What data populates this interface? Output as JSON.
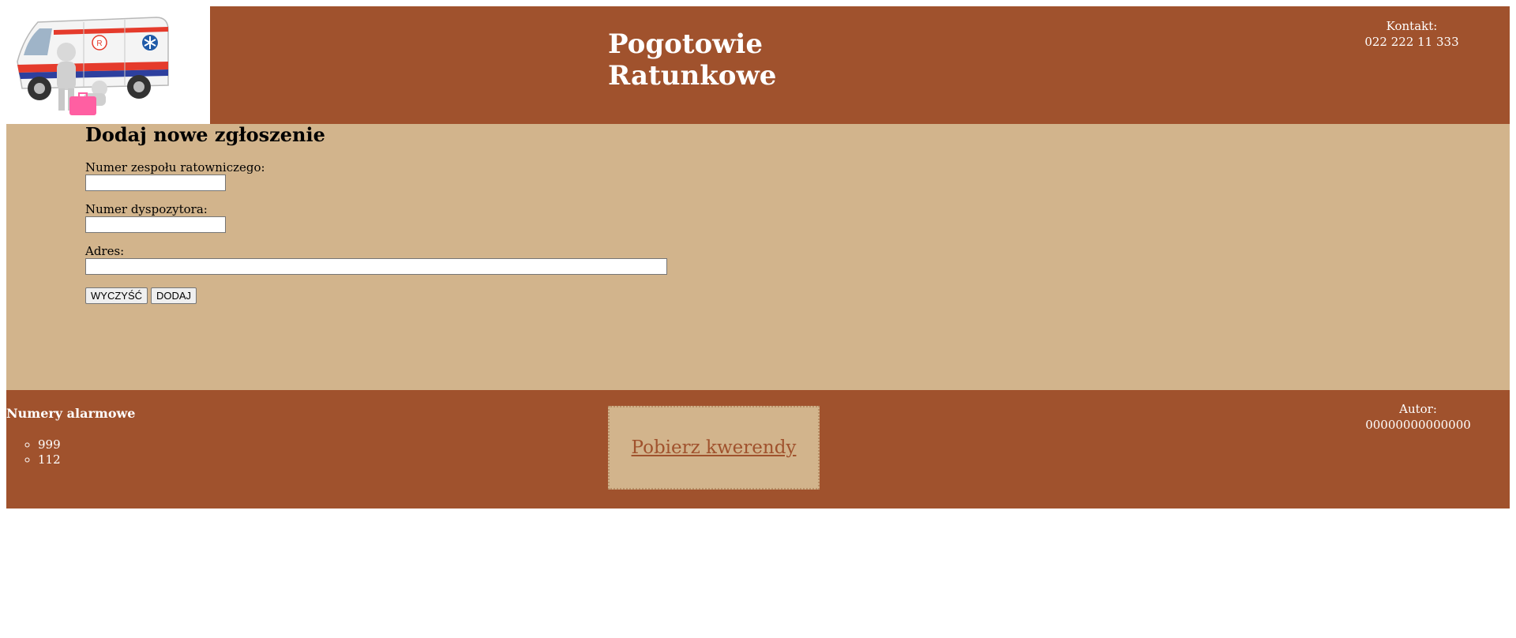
{
  "header": {
    "title": "Pogotowie Ratunkowe",
    "contact_label": "Kontakt:",
    "contact_phone": "022 222 11 333",
    "logo": "ambulance-image"
  },
  "form": {
    "title": "Dodaj nowe zgłoszenie",
    "team_number_label": "Numer zespołu ratowniczego:",
    "team_number_value": "",
    "dispatcher_number_label": "Numer dyspozytora:",
    "dispatcher_number_value": "",
    "address_label": "Adres:",
    "address_value": "",
    "clear_button": "WYCZYŚĆ",
    "add_button": "DODAJ"
  },
  "footer": {
    "alarm_title": "Numery alarmowe",
    "alarm_numbers": [
      "999",
      "112"
    ],
    "download_link": "Pobierz kwerendy",
    "author_label": "Autor:",
    "author_value": "00000000000000"
  },
  "colors": {
    "brown": "#a0522d",
    "tan": "#d2b48c"
  }
}
